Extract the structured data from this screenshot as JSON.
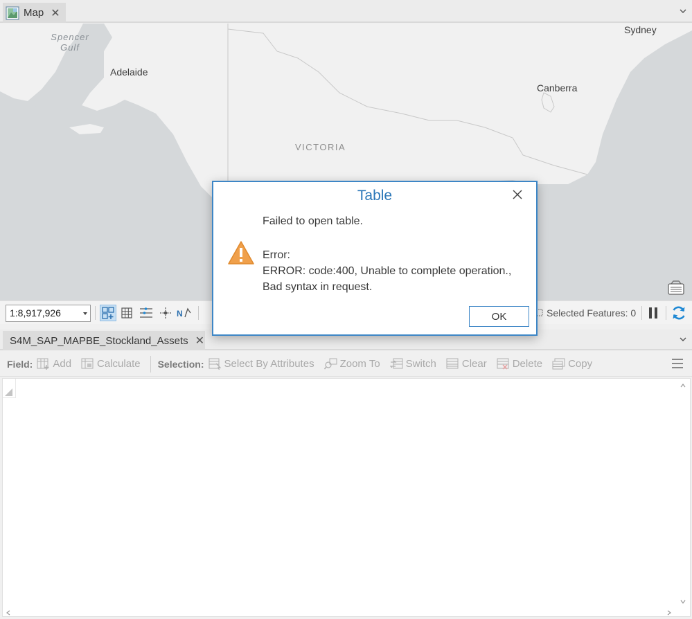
{
  "map_tab": {
    "label": "Map"
  },
  "map": {
    "labels": {
      "sydney": "Sydney",
      "adelaide": "Adelaide",
      "canberra": "Canberra",
      "victoria": "VICTORIA",
      "spencer_gulf_line1": "Spencer",
      "spencer_gulf_line2": "Gulf"
    }
  },
  "map_toolbar": {
    "scale": "1:8,917,926",
    "selected_features": "Selected Features: 0"
  },
  "table_tab": {
    "label": "S4M_SAP_MAPBE_Stockland_Assets"
  },
  "table_toolbar": {
    "field_heading": "Field:",
    "add": "Add",
    "calculate": "Calculate",
    "selection_heading": "Selection:",
    "select_by_attributes": "Select By Attributes",
    "zoom_to": "Zoom To",
    "switch": "Switch",
    "clear": "Clear",
    "delete": "Delete",
    "copy": "Copy"
  },
  "dialog": {
    "title": "Table",
    "message": "Failed to open table.",
    "error_label": "Error:",
    "error_line1": "ERROR: code:400, Unable to complete operation.,",
    "error_line2": "Bad syntax in request.",
    "ok_label": "OK"
  },
  "colors": {
    "accent": "#3d86c6",
    "dialog_title": "#2b77b8",
    "warning": "#f0a04b",
    "refresh": "#1e88d4"
  }
}
